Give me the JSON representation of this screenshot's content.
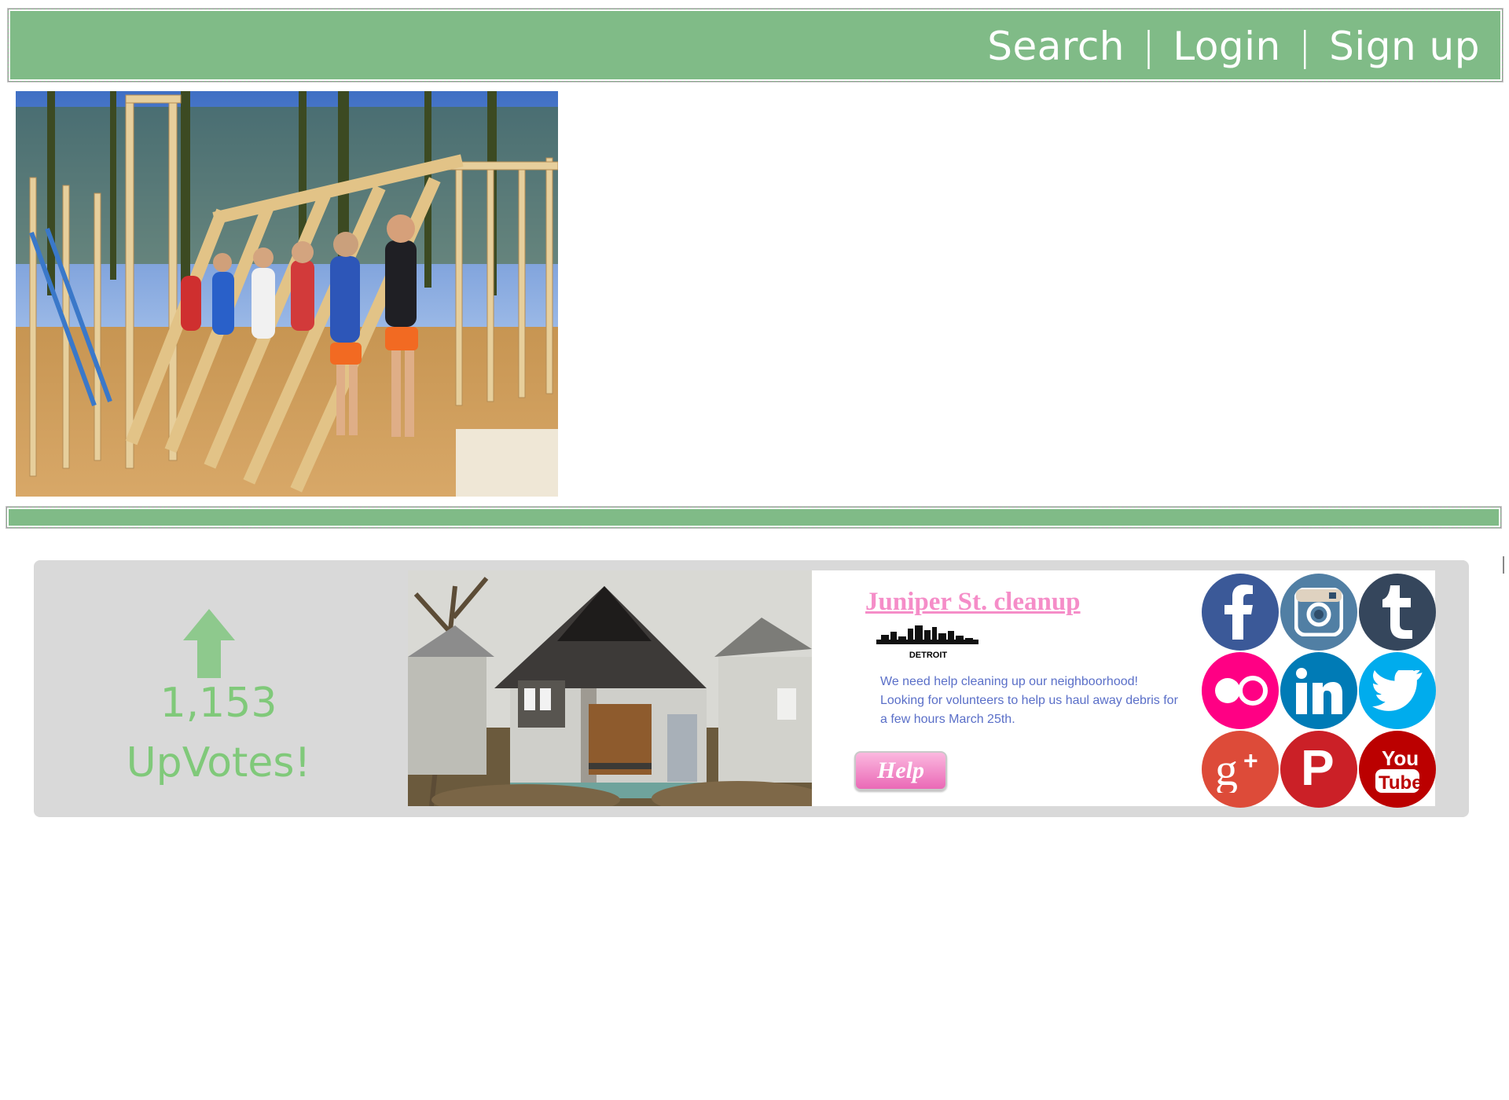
{
  "header": {
    "search_label": "Search",
    "login_label": "Login",
    "signup_label": "Sign up",
    "separator": "|",
    "bar_color": "#80bb87"
  },
  "hero": {
    "image_icon": "volunteers-raising-wall-photo"
  },
  "project_card": {
    "upvote_icon": "up-arrow-icon",
    "upvote_count": "1,153",
    "upvote_label": "UpVotes!",
    "title": "Juniper St. cleanup",
    "city_label": "DETROIT",
    "city_icon": "detroit-skyline-icon",
    "description": "We need help cleaning up our neighboorhood! Looking for volunteers to help us haul away debris for a few hours March 25th.",
    "help_button_label": "Help",
    "photo_icon": "abandoned-house-photo",
    "accent_color": "#f58dc8",
    "text_color": "#5a6fc8"
  },
  "social": [
    {
      "name": "facebook",
      "color": "#3b5998"
    },
    {
      "name": "instagram",
      "color": "#517fa4"
    },
    {
      "name": "tumblr",
      "color": "#35465c"
    },
    {
      "name": "flickr",
      "color": "#ff0084"
    },
    {
      "name": "linkedin",
      "color": "#007bb6"
    },
    {
      "name": "twitter",
      "color": "#00aced"
    },
    {
      "name": "google-plus",
      "color": "#dd4b39"
    },
    {
      "name": "pinterest",
      "color": "#cb2027"
    },
    {
      "name": "youtube",
      "color": "#bb0000"
    }
  ]
}
